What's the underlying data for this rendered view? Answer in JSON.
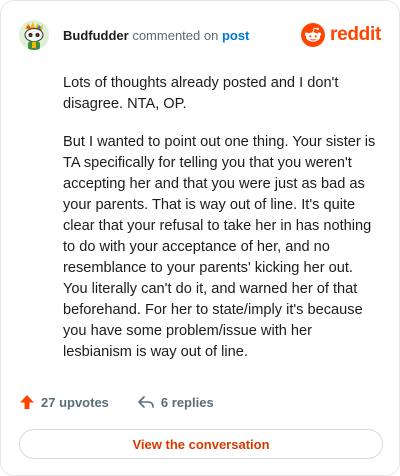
{
  "header": {
    "username": "Budfudder",
    "action_text": " commented on ",
    "post_link": "post",
    "brand_name": "reddit"
  },
  "comment": {
    "paragraphs": [
      "Lots of thoughts already posted and I don't disagree. NTA, OP.",
      "But I wanted to point out one thing. Your sister is TA specifically for telling you that you weren't accepting her and that you were just as bad as your parents. That is way out of line. It's quite clear that your refusal to take her in has nothing to do with your acceptance of her, and no resemblance to your parents' kicking her out. You literally can't do it, and warned her of that beforehand. For her to state/imply it's because you have some problem/issue with her lesbianism is way out of line."
    ]
  },
  "stats": {
    "upvotes": "27 upvotes",
    "replies": "6 replies"
  },
  "cta": {
    "label": "View the conversation"
  },
  "colors": {
    "brand": "#ff4500",
    "link": "#0079d3",
    "cta_text": "#d93a00",
    "upvote_arrow": "#ff4500"
  },
  "icons": {
    "avatar": "snoo-avatar",
    "brand": "reddit-logo-icon",
    "upvote": "upvote-arrow-icon",
    "reply": "reply-arrow-icon"
  }
}
